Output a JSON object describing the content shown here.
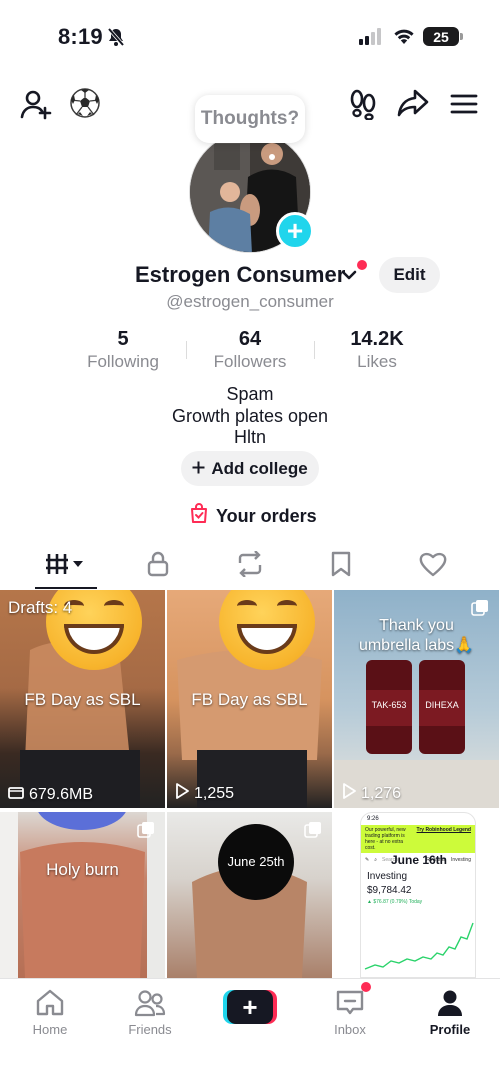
{
  "status_bar": {
    "time": "8:19",
    "battery": "25"
  },
  "thoughts_bubble": "Thoughts?",
  "profile": {
    "display_name": "Estrogen Consumer",
    "username": "@estrogen_consumer",
    "edit_label": "Edit"
  },
  "stats": [
    {
      "value": "5",
      "label": "Following"
    },
    {
      "value": "64",
      "label": "Followers"
    },
    {
      "value": "14.2K",
      "label": "Likes"
    }
  ],
  "bio": {
    "line1": "Spam",
    "line2": "Growth plates open",
    "line3": "Hltn"
  },
  "add_college_label": "Add college",
  "orders_label": "Your orders",
  "tabs": [
    "videos-grid-icon",
    "lock-icon",
    "repost-icon",
    "bookmark-icon",
    "heart-icon"
  ],
  "grid": [
    {
      "drafts": "Drafts: 4",
      "caption": "FB Day as SBL",
      "meta": "679.6MB"
    },
    {
      "caption": "FB Day as SBL",
      "views": "1,255"
    },
    {
      "caption": "Thank you umbrella labs🙏",
      "views": "1,276",
      "bottle1": "TAK-653",
      "bottle2": "DIHEXA"
    },
    {
      "caption": "Holy burn"
    },
    {
      "caption": "June 25th"
    },
    {
      "caption": "June 16th",
      "screen": {
        "time": "9:26",
        "banner": "Our powerful, new trading platform is here - at no extra cost.",
        "banner_link": "Try Robinhood Legend",
        "search_placeholder": "Search",
        "tab_rewards": "Rewards",
        "tab_investing": "Investing",
        "title": "Investing",
        "value": "$9,784.42",
        "change": "▲ $76.87 (0.79%) Today"
      }
    }
  ],
  "bottom_nav": {
    "home": "Home",
    "friends": "Friends",
    "inbox": "Inbox",
    "profile": "Profile"
  },
  "colors": {
    "accent_red": "#fe2c55",
    "accent_cyan": "#20d5ec",
    "muted": "#8a8b91"
  }
}
